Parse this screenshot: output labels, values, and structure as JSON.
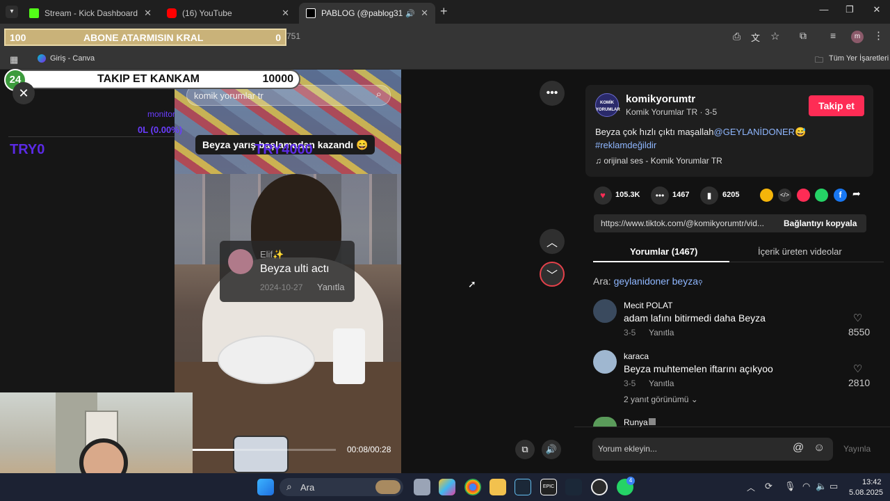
{
  "browser": {
    "tabs": [
      {
        "title": "Stream - Kick Dashboard",
        "favicon_color": "#53fc18"
      },
      {
        "title": "(16) YouTube",
        "favicon_color": "#ff0000"
      },
      {
        "title": "PABLOG (@pablog31.1) | Ti",
        "favicon_color": "#ffffff"
      }
    ],
    "new_tab": "+",
    "address_tail": "751",
    "bookmarks": {
      "apps_icon": "apps-grid",
      "canva": "Giriş - Canva",
      "all_bookmarks": "Tüm Yer İşaretleri"
    },
    "profile_initial": "m"
  },
  "overlay": {
    "goal1": {
      "left": "100",
      "label": "ABONE ATARMISIN KRAL",
      "right": "0"
    },
    "goal2": {
      "badge": "24",
      "label": "TAKIP ET KANKAM",
      "right": "10000"
    },
    "monitor": "monitor",
    "monitor_value": "0L (0.00%)",
    "try_left": "TRY0",
    "try_center": "TRY4000"
  },
  "video": {
    "search_placeholder": "komik yorumlar tr",
    "caption": "Beyza yarış başlamadan kazandı 😄",
    "comment_card": {
      "user": "Elif✨",
      "text": "Beyza ulti actı",
      "date": "2024-10-27",
      "reply": "Yanıtla"
    },
    "time": "00:08/00:28",
    "progress": 0.29
  },
  "side": {
    "author": {
      "handle": "komikyorumtr",
      "name": "Komik Yorumlar TR",
      "date": "3-5",
      "avatar_text": "KOMİK YORUMLAR"
    },
    "follow": "Takip et",
    "description": "Beyza çok hızlı çıktı maşallah",
    "mention": "@GEYLANİDONER",
    "emoji": "😅",
    "hashtag": "#reklamdeğildir",
    "sound": "orijinal ses - Komik Yorumlar TR",
    "likes": "105.3K",
    "comments": "1467",
    "saves": "6205",
    "link": "https://www.tiktok.com/@komikyorumtr/vid...",
    "copy_link": "Bağlantıyı kopyala",
    "tab_comments": "Yorumlar (1467)",
    "tab_creator": "İçerik üreten videolar",
    "search_prefix": "Ara:",
    "search_term": "geylanidoner beyza",
    "comment_list": [
      {
        "user": "Mecit POLAT",
        "text": "adam lafını bitirmedi daha Beyza",
        "date": "3-5",
        "reply": "Yanıtla",
        "likes": "8550",
        "avatar": "#3a4a5e"
      },
      {
        "user": "karaca",
        "text": "Beyza muhtemelen iftarını açıkyoo",
        "date": "3-5",
        "reply": "Yanıtla",
        "likes": "2810",
        "avatar": "#9fb7d0",
        "view_replies": "2 yanıt görünümü"
      },
      {
        "user": "Runya",
        "avatar": "#5a9b5a"
      }
    ],
    "comment_input": "Yorum ekleyin...",
    "post": "Yayınla"
  },
  "taskbar": {
    "search": "Ara",
    "time": "13:42",
    "date": "5.08.2025",
    "whatsapp_badge": "4"
  }
}
